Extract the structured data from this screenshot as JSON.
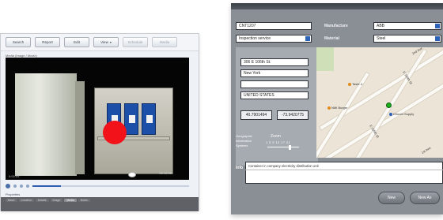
{
  "left_window": {
    "toolbar": [
      {
        "label": "Search",
        "enabled": true,
        "has_caret": false
      },
      {
        "label": "Report",
        "enabled": true,
        "has_caret": false
      },
      {
        "label": "Edit",
        "enabled": true,
        "has_caret": false
      },
      {
        "label": "View",
        "enabled": true,
        "has_caret": true
      },
      {
        "label": "Schedule",
        "enabled": false,
        "has_caret": false
      },
      {
        "label": "Media",
        "enabled": false,
        "has_caret": false
      }
    ],
    "media_label": "Media (Image / Movie)",
    "video_time": "00:15:35",
    "frame_label": "0:00:05",
    "properties_title": "Properties",
    "tabs": [
      "Basic",
      "Location",
      "Details",
      "Image",
      "Media",
      "Notes"
    ],
    "active_tab": "Media",
    "playback_progress": 0.18,
    "marker_color": "#f1121a"
  },
  "right_window": {
    "id_field": "CNT1207",
    "service_field": "Inspection service",
    "manufacture_label": "Manufacture",
    "manufacture_value": "ABB",
    "material_label": "Material",
    "material_value": "Steel",
    "address_line1": "306 E 106th St.",
    "city": "New York",
    "address_line3": "",
    "country": "UNITED STATES",
    "latitude": "40.7901494",
    "longitude": "-73.9420775",
    "graphic_text": [
      "Geographic",
      "Information",
      "Systems"
    ],
    "zoom_label": "Zoom",
    "zoom_levels": "1  5  9  13  17  21",
    "zoom_value": 15,
    "map_labels": [
      "Taste 4",
      "NMI Burger",
      "Church Supply",
      "E 106th St",
      "E 105th St",
      "2nd Ave",
      "1st Ave"
    ],
    "info_label": "Info",
    "info_text": "Container in company electricity distribution unit",
    "buttons": [
      "New",
      "New As"
    ],
    "accent_color": "#2c62b8"
  }
}
